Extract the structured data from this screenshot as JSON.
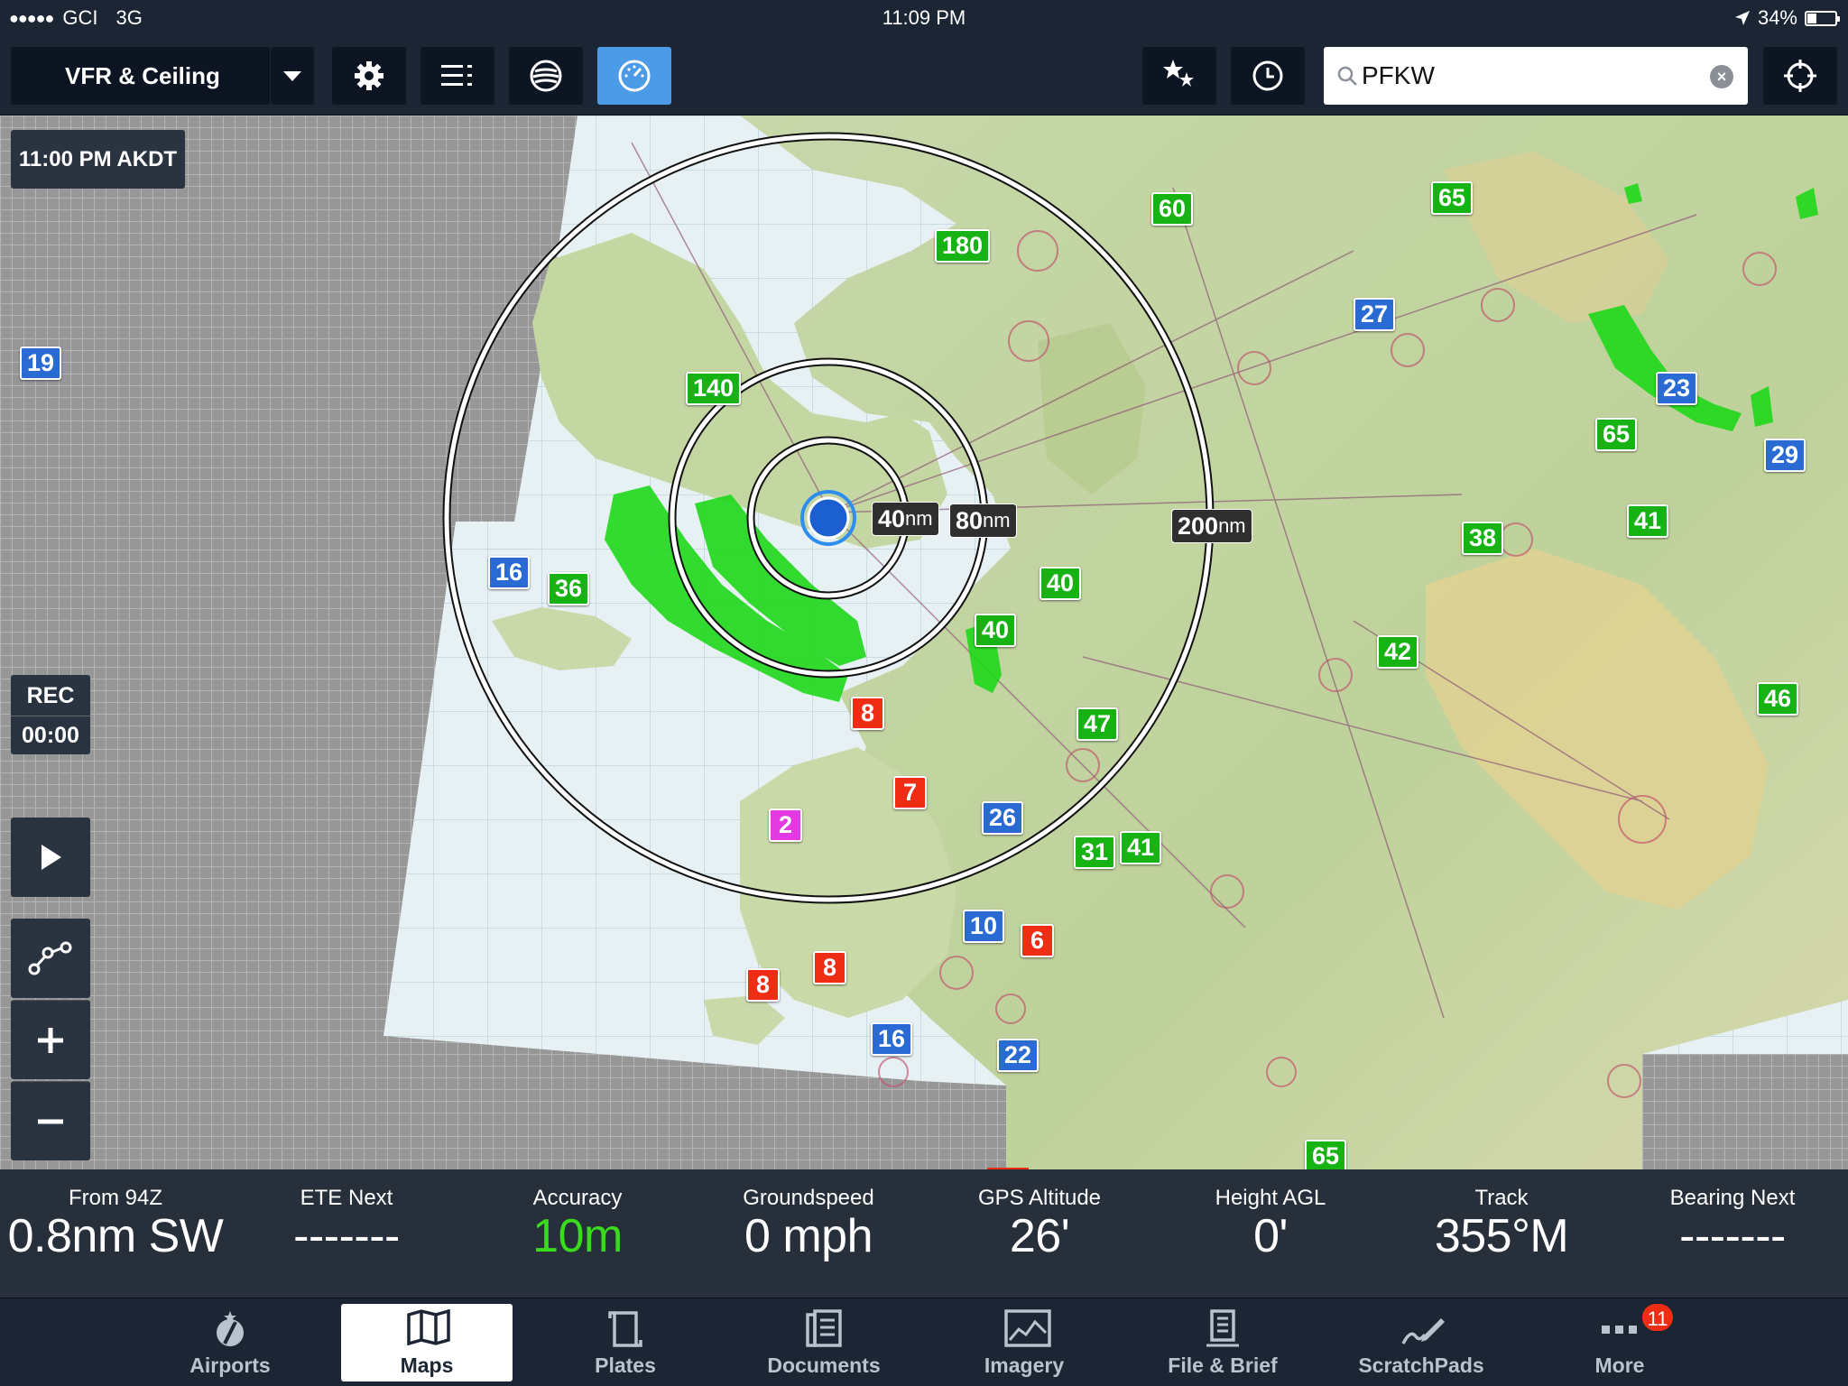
{
  "status_bar": {
    "signal": "●●●●●",
    "carrier": "GCI",
    "network": "3G",
    "time": "11:09 PM",
    "battery_percent": "34%",
    "battery_level": 0.34
  },
  "toolbar": {
    "layer": "VFR & Ceiling",
    "buttons": [
      "settings",
      "layers-list",
      "sectional",
      "instruments",
      "favorites",
      "recent",
      "locate"
    ],
    "search_value": "PFKW",
    "search_placeholder": "Search"
  },
  "map": {
    "time_chip": "11:00 PM AKDT",
    "rec_label": "REC",
    "rec_time": "00:00",
    "range_rings": [
      {
        "value": "40",
        "unit": "nm"
      },
      {
        "value": "80",
        "unit": "nm"
      },
      {
        "value": "200",
        "unit": "nm"
      }
    ],
    "badges": [
      {
        "text": "180",
        "color": "green"
      },
      {
        "text": "60",
        "color": "green"
      },
      {
        "text": "65",
        "color": "green"
      },
      {
        "text": "27",
        "color": "blue"
      },
      {
        "text": "19",
        "color": "blue"
      },
      {
        "text": "140",
        "color": "green"
      },
      {
        "text": "23",
        "color": "blue"
      },
      {
        "text": "65",
        "color": "green"
      },
      {
        "text": "29",
        "color": "blue"
      },
      {
        "text": "41",
        "color": "green"
      },
      {
        "text": "38",
        "color": "green"
      },
      {
        "text": "16",
        "color": "blue"
      },
      {
        "text": "36",
        "color": "green"
      },
      {
        "text": "40",
        "color": "green"
      },
      {
        "text": "40",
        "color": "green"
      },
      {
        "text": "42",
        "color": "green"
      },
      {
        "text": "46",
        "color": "green"
      },
      {
        "text": "8",
        "color": "red"
      },
      {
        "text": "47",
        "color": "green"
      },
      {
        "text": "7",
        "color": "red"
      },
      {
        "text": "2",
        "color": "magenta"
      },
      {
        "text": "26",
        "color": "blue"
      },
      {
        "text": "31",
        "color": "green"
      },
      {
        "text": "41",
        "color": "green"
      },
      {
        "text": "10",
        "color": "blue"
      },
      {
        "text": "6",
        "color": "red"
      },
      {
        "text": "8",
        "color": "red"
      },
      {
        "text": "8",
        "color": "red"
      },
      {
        "text": "16",
        "color": "blue"
      },
      {
        "text": "22",
        "color": "blue"
      },
      {
        "text": "65",
        "color": "green"
      }
    ]
  },
  "instruments": [
    {
      "label": "From 94Z",
      "value": "0.8nm SW"
    },
    {
      "label": "ETE Next",
      "value": "-------"
    },
    {
      "label": "Accuracy",
      "value": "10m",
      "color": "#3adb1c"
    },
    {
      "label": "Groundspeed",
      "value": "0 mph"
    },
    {
      "label": "GPS Altitude",
      "value": "26'"
    },
    {
      "label": "Height AGL",
      "value": "0'"
    },
    {
      "label": "Track",
      "value": "355°M"
    },
    {
      "label": "Bearing Next",
      "value": "-------"
    }
  ],
  "tabs": [
    {
      "label": "Airports",
      "icon": "airports-icon"
    },
    {
      "label": "Maps",
      "icon": "maps-icon",
      "active": true
    },
    {
      "label": "Plates",
      "icon": "plates-icon"
    },
    {
      "label": "Documents",
      "icon": "documents-icon"
    },
    {
      "label": "Imagery",
      "icon": "imagery-icon"
    },
    {
      "label": "File & Brief",
      "icon": "file-brief-icon"
    },
    {
      "label": "ScratchPads",
      "icon": "scratchpads-icon"
    },
    {
      "label": "More",
      "icon": "more-icon",
      "badge": "11"
    }
  ]
}
